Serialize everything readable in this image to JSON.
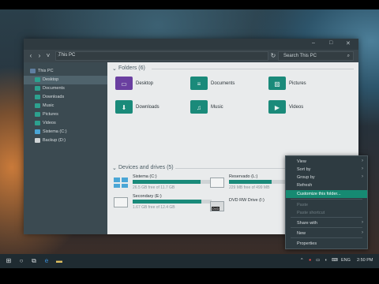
{
  "window": {
    "address_path": "This PC",
    "search_placeholder": "Search This PC",
    "nav": {
      "back": "‹",
      "forward": "›",
      "up": "˅",
      "refresh": "↻"
    }
  },
  "sidebar": {
    "items": [
      {
        "label": "This PC",
        "icon": "computer-icon",
        "color": "#5f7ea0",
        "selected": true
      },
      {
        "label": "Desktop",
        "icon": "desktop-folder-icon",
        "color": "#2da18f",
        "selected": true
      },
      {
        "label": "Documents",
        "icon": "documents-folder-icon",
        "color": "#2da18f"
      },
      {
        "label": "Downloads",
        "icon": "downloads-folder-icon",
        "color": "#2da18f"
      },
      {
        "label": "Music",
        "icon": "music-folder-icon",
        "color": "#2da18f"
      },
      {
        "label": "Pictures",
        "icon": "pictures-folder-icon",
        "color": "#2da18f"
      },
      {
        "label": "Videos",
        "icon": "videos-folder-icon",
        "color": "#2da18f"
      },
      {
        "label": "Sistema (C:)",
        "icon": "windows-drive-icon",
        "color": "#4aa6d6"
      },
      {
        "label": "Backup (D:)",
        "icon": "drive-icon",
        "color": "#cfd4d6"
      }
    ]
  },
  "folders": {
    "header": "Folders (6)",
    "items": [
      {
        "label": "Desktop",
        "icon": "desktop-folder-icon",
        "glyph": "▭"
      },
      {
        "label": "Documents",
        "icon": "documents-folder-icon",
        "glyph": "≡"
      },
      {
        "label": "Pictures",
        "icon": "pictures-folder-icon",
        "glyph": "▨"
      },
      {
        "label": "Downloads",
        "icon": "downloads-folder-icon",
        "glyph": "⬇"
      },
      {
        "label": "Music",
        "icon": "music-folder-icon",
        "glyph": "♫"
      },
      {
        "label": "Videos",
        "icon": "videos-folder-icon",
        "glyph": "▶"
      }
    ]
  },
  "drives": {
    "header": "Devices and drives (5)",
    "items": [
      {
        "name": "Sistema (C:)",
        "free": "26.5 GB free of 11.7 GB",
        "used_fraction": 0.86,
        "icon": "windows-drive-icon"
      },
      {
        "name": "Reservado (L:)",
        "free": "229 MB free of 499 MB",
        "used_fraction": 0.54,
        "icon": "drive-icon"
      },
      {
        "name": "Secondary (E:)",
        "free": "1.67 GB free of 12.4 GB",
        "used_fraction": 0.87,
        "icon": "drive-icon"
      },
      {
        "name": "DVD RW Drive (I:)",
        "free": "",
        "used_fraction": null,
        "icon": "dvd-drive-icon"
      }
    ]
  },
  "context_menu": {
    "items": [
      {
        "label": "View",
        "submenu": true
      },
      {
        "label": "Sort by",
        "submenu": true
      },
      {
        "label": "Group by",
        "submenu": true
      },
      {
        "label": "Refresh"
      },
      {
        "label": "Customize this folder...",
        "highlighted": true
      },
      {
        "label": "Paste",
        "disabled": true
      },
      {
        "label": "Paste shortcut",
        "disabled": true
      },
      {
        "label": "Share with",
        "submenu": true
      },
      {
        "label": "New",
        "submenu": true
      },
      {
        "label": "Properties"
      }
    ]
  },
  "taskbar": {
    "language": "ENG",
    "time": "2:50 PM"
  },
  "colors": {
    "accent": "#1a8a7a",
    "highlight": "#168a72"
  }
}
